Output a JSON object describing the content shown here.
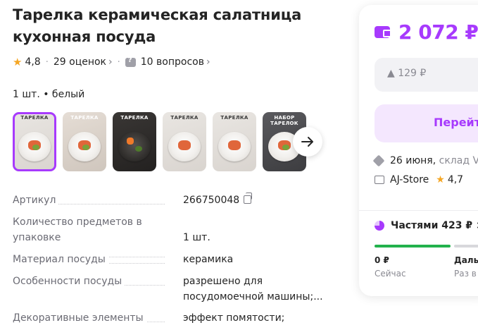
{
  "product": {
    "title": "Тарелка керамическая салатница кухонная посуда",
    "rating": "4,8",
    "reviews": "29 оценок",
    "questions": "10 вопросов",
    "variant": "1 шт. • белый"
  },
  "gallery": {
    "thumbnails": [
      {
        "caption": "ТАРЕЛКА",
        "alt": "white plate with salad"
      },
      {
        "caption": "ТАРЕЛКА",
        "alt": "white plate with salmon"
      },
      {
        "caption": "ТАРЕЛКА",
        "alt": "black plate with tomatoes"
      },
      {
        "caption": "ТАРЕЛКА",
        "alt": "plate with dessert"
      },
      {
        "caption": "ТАРЕЛКА",
        "alt": "plate with dessert"
      },
      {
        "caption": "НАБОР ТАРЕЛОК",
        "alt": "plate set"
      }
    ]
  },
  "specs": [
    {
      "key": "Артикул",
      "value": "266750048"
    },
    {
      "key": "Количество предметов в упаковке",
      "value": "1 шт."
    },
    {
      "key": "Материал посуды",
      "value": "керамика"
    },
    {
      "key": "Особенности посуды",
      "value": "разрешено для посудомоечной машины;..."
    },
    {
      "key": "Декоративные элементы",
      "value": "эффект помятости;"
    }
  ],
  "buybox": {
    "price": "2 072 ₽",
    "old_price": "▲ 129 ₽",
    "cta": "Перейт",
    "delivery_date": "26 июня,",
    "delivery_warehouse": "склад V",
    "seller": "AJ-Store",
    "seller_rating": "4,7",
    "installments": "Частями 423 ₽ ×",
    "plan_now_amount": "0 ₽",
    "plan_now_label": "Сейчас",
    "plan_later_amount": "Даль",
    "plan_later_label": "Раз в"
  },
  "colors": {
    "accent": "#a73afd",
    "accent_light": "#f4e7fe",
    "star": "#f5a623",
    "success": "#22b24c"
  }
}
